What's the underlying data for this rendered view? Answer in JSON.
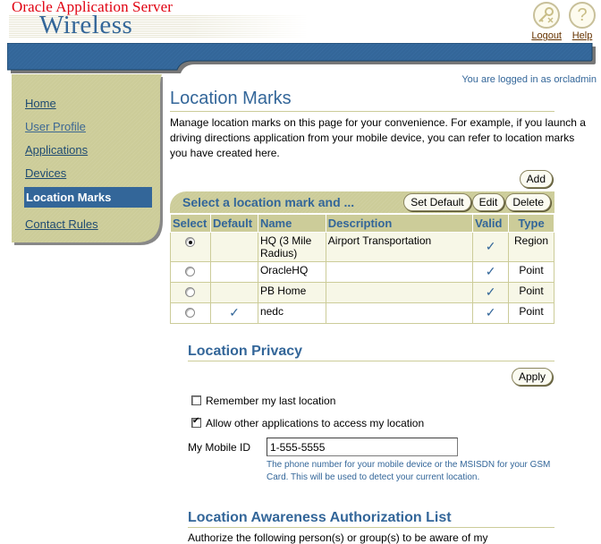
{
  "header": {
    "brand_top": "Oracle Application Server",
    "brand_main": "Wireless",
    "global_buttons": [
      {
        "label": "Logout",
        "icon": "key-icon"
      },
      {
        "label": "Help",
        "icon": "question-icon"
      }
    ],
    "logged_in_text": "You are logged in as orcladmin"
  },
  "sidebar": {
    "items": [
      {
        "label": "Home",
        "active": false
      },
      {
        "label": "User Profile",
        "active": false
      },
      {
        "label": "Applications",
        "active": false
      },
      {
        "label": "Devices",
        "active": false
      },
      {
        "label": "Location Marks",
        "active": true
      },
      {
        "label": "Contact Rules",
        "active": false
      }
    ]
  },
  "main": {
    "title": "Location Marks",
    "intro": "Manage location marks on this page for your convenience. For example, if you launch a driving directions application from your mobile device, you can refer to location marks you have created here.",
    "add_label": "Add",
    "table_bar_title": "Select a location mark and ...",
    "table_actions": {
      "set_default": "Set Default",
      "edit": "Edit",
      "delete": "Delete"
    },
    "columns": [
      "Select",
      "Default",
      "Name",
      "Description",
      "Valid",
      "Type"
    ],
    "rows": [
      {
        "selected": true,
        "default": "",
        "name": "HQ (3 Mile Radius)",
        "description": "Airport Transportation",
        "valid": "✓",
        "type": "Region"
      },
      {
        "selected": false,
        "default": "",
        "name": "OracleHQ",
        "description": "",
        "valid": "✓",
        "type": "Point"
      },
      {
        "selected": false,
        "default": "",
        "name": "PB Home",
        "description": "",
        "valid": "✓",
        "type": "Point"
      },
      {
        "selected": false,
        "default": "✓",
        "name": "nedc",
        "description": "",
        "valid": "✓",
        "type": "Point"
      }
    ]
  },
  "privacy": {
    "title": "Location Privacy",
    "apply_label": "Apply",
    "remember_label": "Remember my last location",
    "remember_checked": false,
    "allow_label": "Allow other applications to access my location",
    "allow_checked": true,
    "mobile_label": "My Mobile ID",
    "mobile_value": "1-555-5555",
    "mobile_hint": "The phone number for your mobile device or the MSISDN for your GSM Card. This will be used to detect your current location."
  },
  "auth": {
    "title": "Location Awareness Authorization List",
    "text": "Authorize the following person(s) or group(s) to be aware of my"
  },
  "colors": {
    "brand_blue": "#336699",
    "tan": "#cccc99",
    "brand_red": "#e00010",
    "link_brown": "#663300"
  }
}
